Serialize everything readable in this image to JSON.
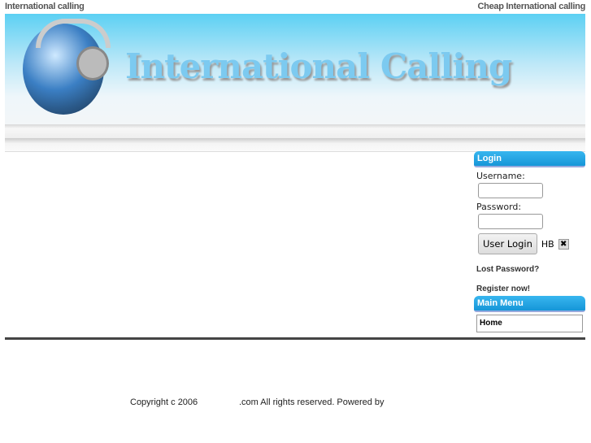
{
  "top": {
    "left": "International calling",
    "right": "Cheap International calling"
  },
  "banner": {
    "title": "International Calling"
  },
  "login": {
    "header": "Login",
    "username_label": "Username:",
    "password_label": "Password:",
    "button": "User Login",
    "hb": "HB",
    "close": "✖",
    "lost": "Lost Password?",
    "register": "Register now!"
  },
  "menu": {
    "header": "Main Menu",
    "items": [
      "Home"
    ]
  },
  "footer": {
    "copyright": "Copyright c 2006",
    "rights": ".com All rights reserved. Powered by"
  }
}
